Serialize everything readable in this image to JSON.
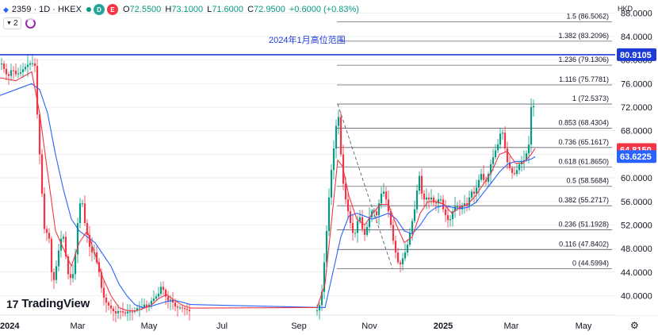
{
  "header": {
    "symbol_line": "2359 · 1D · HKEX",
    "ohlc": [
      {
        "k": "O",
        "v": "72.5500"
      },
      {
        "k": "H",
        "v": "73.1000"
      },
      {
        "k": "L",
        "v": "71.6000"
      },
      {
        "k": "C",
        "v": "72.9500"
      }
    ],
    "change": "+0.6000 (+0.83%)",
    "indicator_count": "2",
    "status_dot_color": "#089981",
    "pill_icons": [
      "D",
      "E"
    ]
  },
  "brand": "TradingView",
  "currency": "HKD",
  "annotation": "2024年1月高位范围",
  "chart_data": {
    "type": "line",
    "title": "",
    "xlabel": "",
    "ylabel": "",
    "ylim": [
      36.7,
      90.2
    ],
    "x_ticks": [
      "2024",
      "Mar",
      "May",
      "Jul",
      "Sep",
      "Nov",
      "2025",
      "Mar",
      "May"
    ],
    "y_ticks": [
      40,
      44,
      48,
      52,
      56,
      60,
      64,
      68,
      72,
      76,
      80,
      84,
      88
    ],
    "price_labels": [
      {
        "text": "80.9105",
        "value": 80.9105,
        "color": "#1e3bd6"
      },
      {
        "text": "64.8150",
        "value": 64.815,
        "color": "#f23645"
      },
      {
        "text": "63.6225",
        "value": 63.6225,
        "color": "#2962ff"
      }
    ],
    "fib_levels": [
      {
        "ratio": "1.5",
        "label": "1.5 (86.5062)",
        "value": 86.5062
      },
      {
        "ratio": "1.382",
        "label": "1.382 (83.2096)",
        "value": 83.2096
      },
      {
        "ratio": "1.236",
        "label": "1.236 (79.1306)",
        "value": 79.1306
      },
      {
        "ratio": "1.116",
        "label": "1.116 (75.7781)",
        "value": 75.7781
      },
      {
        "ratio": "1",
        "label": "1 (72.5373)",
        "value": 72.5373
      },
      {
        "ratio": "0.853",
        "label": "0.853 (68.4304)",
        "value": 68.4304
      },
      {
        "ratio": "0.736",
        "label": "0.736 (65.1617)",
        "value": 65.1617
      },
      {
        "ratio": "0.618",
        "label": "0.618 (61.8650)",
        "value": 61.865
      },
      {
        "ratio": "0.5",
        "label": "0.5 (58.5684)",
        "value": 58.5684
      },
      {
        "ratio": "0.382",
        "label": "0.382 (55.2717)",
        "value": 55.2717
      },
      {
        "ratio": "0.236",
        "label": "0.236 (51.1928)",
        "value": 51.1928
      },
      {
        "ratio": "0.116",
        "label": "0.116 (47.8402)",
        "value": 47.8402
      },
      {
        "ratio": "0",
        "label": "0 (44.5994)",
        "value": 44.5994
      }
    ],
    "resistance_line": {
      "value": 80.9105,
      "color": "#1e3bd6"
    },
    "colors": {
      "up": "#089981",
      "down": "#f23645",
      "ma_fast": "#f23645",
      "ma_slow": "#2962ff",
      "grid": "#e0e3eb",
      "fib": "#787b86"
    },
    "price_path": [
      [
        0,
        80
      ],
      [
        5,
        78.5
      ],
      [
        10,
        77
      ],
      [
        15,
        78.6
      ],
      [
        20,
        77.6
      ],
      [
        25,
        77.8
      ],
      [
        30,
        78.6
      ],
      [
        35,
        79.2
      ],
      [
        40,
        79.6
      ],
      [
        44,
        79
      ],
      [
        48,
        68
      ],
      [
        52,
        60
      ],
      [
        55,
        52
      ],
      [
        58,
        50
      ],
      [
        61,
        52
      ],
      [
        64,
        45
      ],
      [
        67,
        42
      ],
      [
        70,
        44
      ],
      [
        73,
        47
      ],
      [
        76,
        49
      ],
      [
        79,
        51
      ],
      [
        82,
        48
      ],
      [
        85,
        44
      ],
      [
        88,
        43
      ],
      [
        91,
        43
      ],
      [
        94,
        45
      ],
      [
        97,
        51
      ],
      [
        100,
        55
      ],
      [
        103,
        57
      ],
      [
        106,
        53
      ],
      [
        109,
        51
      ],
      [
        112,
        49
      ],
      [
        115,
        47
      ],
      [
        118,
        48
      ],
      [
        121,
        46
      ],
      [
        124,
        45
      ],
      [
        127,
        42
      ],
      [
        130,
        40
      ],
      [
        133,
        39
      ],
      [
        136,
        38.5
      ],
      [
        139,
        38
      ],
      [
        142,
        37.5
      ],
      [
        146,
        37
      ],
      [
        150,
        37.5
      ],
      [
        154,
        37.2
      ],
      [
        158,
        37
      ],
      [
        162,
        37.4
      ],
      [
        166,
        37.2
      ],
      [
        170,
        37.5
      ],
      [
        174,
        38
      ],
      [
        178,
        38
      ],
      [
        182,
        38.5
      ],
      [
        186,
        38
      ],
      [
        190,
        39
      ],
      [
        194,
        39.5
      ],
      [
        198,
        40
      ],
      [
        201,
        40.5
      ],
      [
        204,
        42
      ],
      [
        207,
        40.5
      ],
      [
        210,
        39.5
      ],
      [
        213,
        39
      ],
      [
        216,
        39.5
      ],
      [
        219,
        38.5
      ],
      [
        222,
        38
      ],
      [
        225,
        38
      ],
      [
        228,
        38
      ],
      [
        232,
        37.8
      ],
      [
        236,
        37.6
      ],
      [
        240,
        37.3
      ],
      [
        390,
        36.8
      ],
      [
        400,
        37.5
      ],
      [
        405,
        39
      ],
      [
        408,
        44
      ],
      [
        411,
        49
      ],
      [
        414,
        55
      ],
      [
        417,
        60
      ],
      [
        420,
        64
      ],
      [
        423,
        67
      ],
      [
        426,
        72.5
      ],
      [
        429,
        66
      ],
      [
        432,
        60
      ],
      [
        435,
        57
      ],
      [
        438,
        55
      ],
      [
        441,
        53
      ],
      [
        444,
        51
      ],
      [
        447,
        50
      ],
      [
        450,
        52
      ],
      [
        453,
        54
      ],
      [
        456,
        52
      ],
      [
        459,
        50
      ],
      [
        462,
        51
      ],
      [
        465,
        53
      ],
      [
        468,
        54
      ],
      [
        471,
        55
      ],
      [
        474,
        53
      ],
      [
        477,
        55
      ],
      [
        480,
        57
      ],
      [
        483,
        58
      ],
      [
        486,
        57
      ],
      [
        489,
        55
      ],
      [
        492,
        53
      ],
      [
        495,
        50
      ],
      [
        498,
        48
      ],
      [
        501,
        46
      ],
      [
        504,
        45
      ],
      [
        507,
        46
      ],
      [
        510,
        47
      ],
      [
        513,
        48
      ],
      [
        516,
        50
      ],
      [
        519,
        52
      ],
      [
        522,
        54
      ],
      [
        525,
        56
      ],
      [
        528,
        61.5
      ],
      [
        531,
        58
      ],
      [
        534,
        56
      ],
      [
        537,
        57
      ],
      [
        540,
        56
      ],
      [
        543,
        57
      ],
      [
        546,
        56
      ],
      [
        549,
        55.5
      ],
      [
        552,
        56
      ],
      [
        555,
        57
      ],
      [
        558,
        55
      ],
      [
        561,
        54
      ],
      [
        564,
        53
      ],
      [
        567,
        52.5
      ],
      [
        570,
        54
      ],
      [
        573,
        55
      ],
      [
        576,
        55.5
      ],
      [
        579,
        54.5
      ],
      [
        582,
        55
      ],
      [
        585,
        56
      ],
      [
        588,
        55
      ],
      [
        591,
        56
      ],
      [
        594,
        58
      ],
      [
        597,
        57
      ],
      [
        600,
        58
      ],
      [
        603,
        59
      ],
      [
        606,
        61
      ],
      [
        609,
        60
      ],
      [
        612,
        59
      ],
      [
        615,
        60
      ],
      [
        618,
        62
      ],
      [
        621,
        63
      ],
      [
        624,
        64.5
      ],
      [
        627,
        65
      ],
      [
        630,
        67
      ],
      [
        633,
        68.5
      ],
      [
        636,
        66
      ],
      [
        639,
        63
      ],
      [
        642,
        62
      ],
      [
        645,
        61
      ],
      [
        648,
        60.5
      ],
      [
        651,
        61
      ],
      [
        654,
        62
      ],
      [
        657,
        63
      ],
      [
        660,
        62.5
      ],
      [
        663,
        64
      ],
      [
        666,
        64.5
      ],
      [
        669,
        68
      ],
      [
        671,
        76
      ],
      [
        673,
        72.2
      ],
      [
        675,
        72.9
      ]
    ],
    "ma_fast_path": [
      [
        0,
        77
      ],
      [
        20,
        76.5
      ],
      [
        40,
        78
      ],
      [
        50,
        71
      ],
      [
        60,
        61
      ],
      [
        70,
        51
      ],
      [
        80,
        48
      ],
      [
        90,
        45
      ],
      [
        100,
        49
      ],
      [
        110,
        51
      ],
      [
        120,
        47
      ],
      [
        130,
        43
      ],
      [
        140,
        40
      ],
      [
        150,
        38
      ],
      [
        160,
        37.5
      ],
      [
        170,
        37.4
      ],
      [
        180,
        37.8
      ],
      [
        190,
        38.3
      ],
      [
        200,
        39.5
      ],
      [
        210,
        40.2
      ],
      [
        220,
        39.2
      ],
      [
        230,
        38.4
      ],
      [
        240,
        37.9
      ],
      [
        400,
        38
      ],
      [
        410,
        42
      ],
      [
        420,
        55
      ],
      [
        426,
        63
      ],
      [
        432,
        62
      ],
      [
        440,
        57
      ],
      [
        450,
        53
      ],
      [
        460,
        52
      ],
      [
        470,
        54
      ],
      [
        480,
        55.5
      ],
      [
        490,
        55.5
      ],
      [
        500,
        52
      ],
      [
        510,
        49
      ],
      [
        520,
        50
      ],
      [
        530,
        54
      ],
      [
        540,
        56
      ],
      [
        550,
        56
      ],
      [
        560,
        55.5
      ],
      [
        570,
        54
      ],
      [
        580,
        55
      ],
      [
        590,
        55.5
      ],
      [
        600,
        57
      ],
      [
        610,
        59
      ],
      [
        620,
        61
      ],
      [
        630,
        64
      ],
      [
        640,
        64.5
      ],
      [
        650,
        62.5
      ],
      [
        660,
        62.5
      ],
      [
        670,
        64
      ],
      [
        675,
        65
      ]
    ],
    "ma_slow_path": [
      [
        0,
        74
      ],
      [
        20,
        75
      ],
      [
        40,
        76
      ],
      [
        50,
        75
      ],
      [
        60,
        71
      ],
      [
        70,
        64
      ],
      [
        80,
        58
      ],
      [
        90,
        53
      ],
      [
        100,
        51
      ],
      [
        110,
        50
      ],
      [
        120,
        49
      ],
      [
        130,
        47
      ],
      [
        140,
        45
      ],
      [
        150,
        42
      ],
      [
        160,
        40
      ],
      [
        170,
        38.5
      ],
      [
        180,
        38
      ],
      [
        190,
        38.2
      ],
      [
        200,
        38.6
      ],
      [
        210,
        39
      ],
      [
        220,
        39.2
      ],
      [
        230,
        38.9
      ],
      [
        240,
        38.5
      ],
      [
        410,
        38
      ],
      [
        420,
        44
      ],
      [
        430,
        50
      ],
      [
        440,
        53.5
      ],
      [
        450,
        54
      ],
      [
        460,
        53.5
      ],
      [
        470,
        53
      ],
      [
        480,
        53.5
      ],
      [
        490,
        54
      ],
      [
        500,
        53
      ],
      [
        510,
        51
      ],
      [
        520,
        50.5
      ],
      [
        530,
        52
      ],
      [
        540,
        54
      ],
      [
        550,
        55
      ],
      [
        560,
        55.3
      ],
      [
        570,
        55
      ],
      [
        580,
        54.8
      ],
      [
        590,
        55
      ],
      [
        600,
        55.8
      ],
      [
        610,
        57.5
      ],
      [
        620,
        59.2
      ],
      [
        630,
        61
      ],
      [
        640,
        62.3
      ],
      [
        650,
        62.8
      ],
      [
        660,
        62.8
      ],
      [
        670,
        63.2
      ],
      [
        675,
        63.6
      ]
    ]
  }
}
